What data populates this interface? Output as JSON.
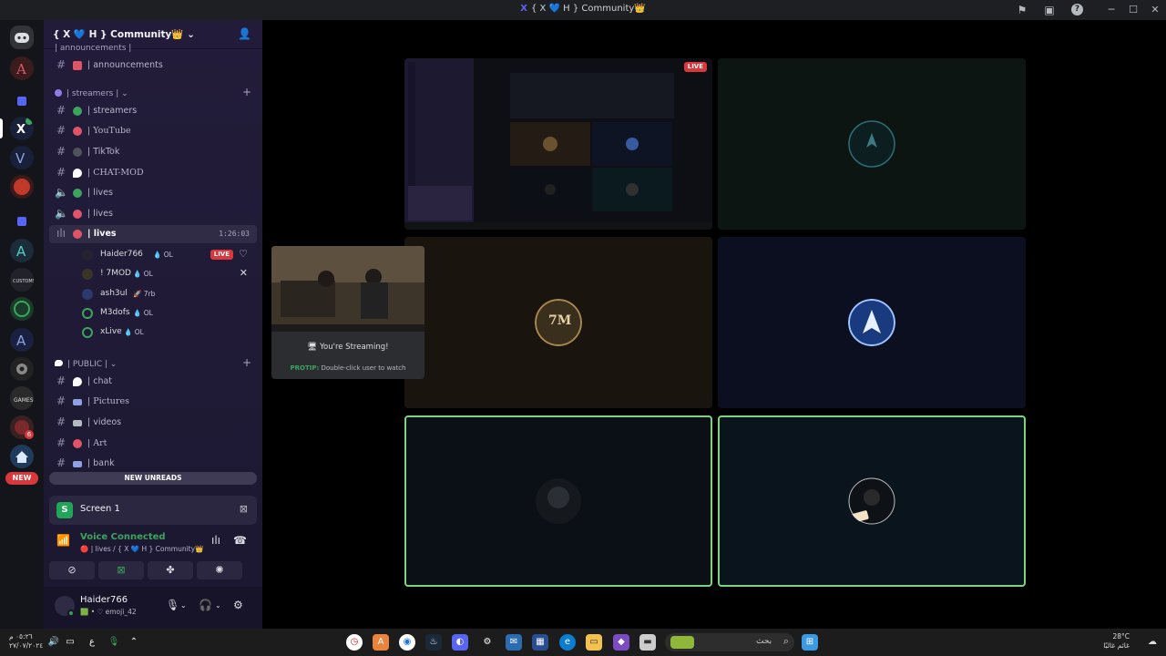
{
  "window": {
    "title": "{ X 💙 H } Community👑",
    "icons": {
      "inbox": "inbox-icon",
      "screen": "screen-share-icon",
      "help": "?"
    },
    "controls": {
      "minimize": "─",
      "maximize": "☐",
      "close": "✕"
    }
  },
  "server": {
    "name": "{ X 💙 H } Community👑",
    "chevron": "⌄",
    "invite_icon": "👤"
  },
  "categories": {
    "announcements": {
      "label": "| announcements |"
    },
    "streamers": {
      "label": "| streamers |"
    },
    "public": {
      "label": "| PUBLIC |"
    }
  },
  "channels": [
    {
      "id": "announcements",
      "label": "| announcements",
      "icon": "📢",
      "color": "#e0546a",
      "type": "text"
    },
    {
      "id": "streamers",
      "label": "| streamers",
      "color": "#3ba55d",
      "type": "text"
    },
    {
      "id": "youtube",
      "label": "| YouTube",
      "color": "#e0546a",
      "type": "text"
    },
    {
      "id": "tiktok",
      "label": "| TikTok",
      "color": "#4f545c",
      "type": "text"
    },
    {
      "id": "chat-mod",
      "label": "| CHAT-MOD",
      "color": "#ffffff",
      "type": "text"
    },
    {
      "id": "lives-1",
      "label": "| lives",
      "color": "#3ba55d",
      "type": "voice"
    },
    {
      "id": "lives-2",
      "label": "| lives",
      "color": "#e0546a",
      "type": "voice"
    },
    {
      "id": "lives-3",
      "label": "| lives",
      "color": "#e0546a",
      "type": "voice",
      "timer": "1:26:03",
      "active": true
    },
    {
      "id": "chat",
      "label": "| chat",
      "color": "#ffffff",
      "type": "text"
    },
    {
      "id": "pictures",
      "label": "| Pictures",
      "color": "#8ea1e1",
      "type": "text"
    },
    {
      "id": "videos",
      "label": "| videos",
      "color": "#b5bac1",
      "type": "text"
    },
    {
      "id": "art",
      "label": "| Art",
      "color": "#e0546a",
      "type": "text"
    },
    {
      "id": "bank",
      "label": "| bank",
      "color": "#8ea1e1",
      "type": "text"
    }
  ],
  "voice_users": [
    {
      "name": "Haider766",
      "tag": "💧 OL",
      "live": "LIVE"
    },
    {
      "name": "! 7MOD",
      "tag": "💧 OL"
    },
    {
      "name": "ash3ul",
      "tag": "🚀 7rb"
    },
    {
      "name": "M3dofs",
      "tag": "💧 OL"
    },
    {
      "name": "xLive",
      "tag": "💧 OL"
    }
  ],
  "new_unreads": "NEW UNREADS",
  "rail_new": "NEW",
  "rail_badge": "6",
  "screen_panel": {
    "label": "Screen 1"
  },
  "voice_panel": {
    "title": "Voice Connected",
    "subtitle": "🔴 | lives / { X 💙 H } Community👑"
  },
  "user_panel": {
    "name": "Haider766",
    "status": "🟩 • ♡ emoji_42"
  },
  "preview": {
    "streaming": "🖥 You're Streaming!",
    "protip_label": "PROTIP:",
    "protip_text": "Double-click user to watch"
  },
  "tiles": {
    "stream_live": "LIVE",
    "avatar_7m": "7M"
  },
  "taskbar": {
    "time": "٠٥:٢٦ م",
    "date": "٢٧/٠٧/٢٠٢٤",
    "lang": "ع",
    "search_placeholder": "بحث",
    "weather_temp": "28°C",
    "weather_label": "غائم غالبًا"
  },
  "colors": {
    "accent": "#5865f2",
    "online": "#23a559",
    "live": "#da373c",
    "speaking_border": "#7ed37e"
  }
}
